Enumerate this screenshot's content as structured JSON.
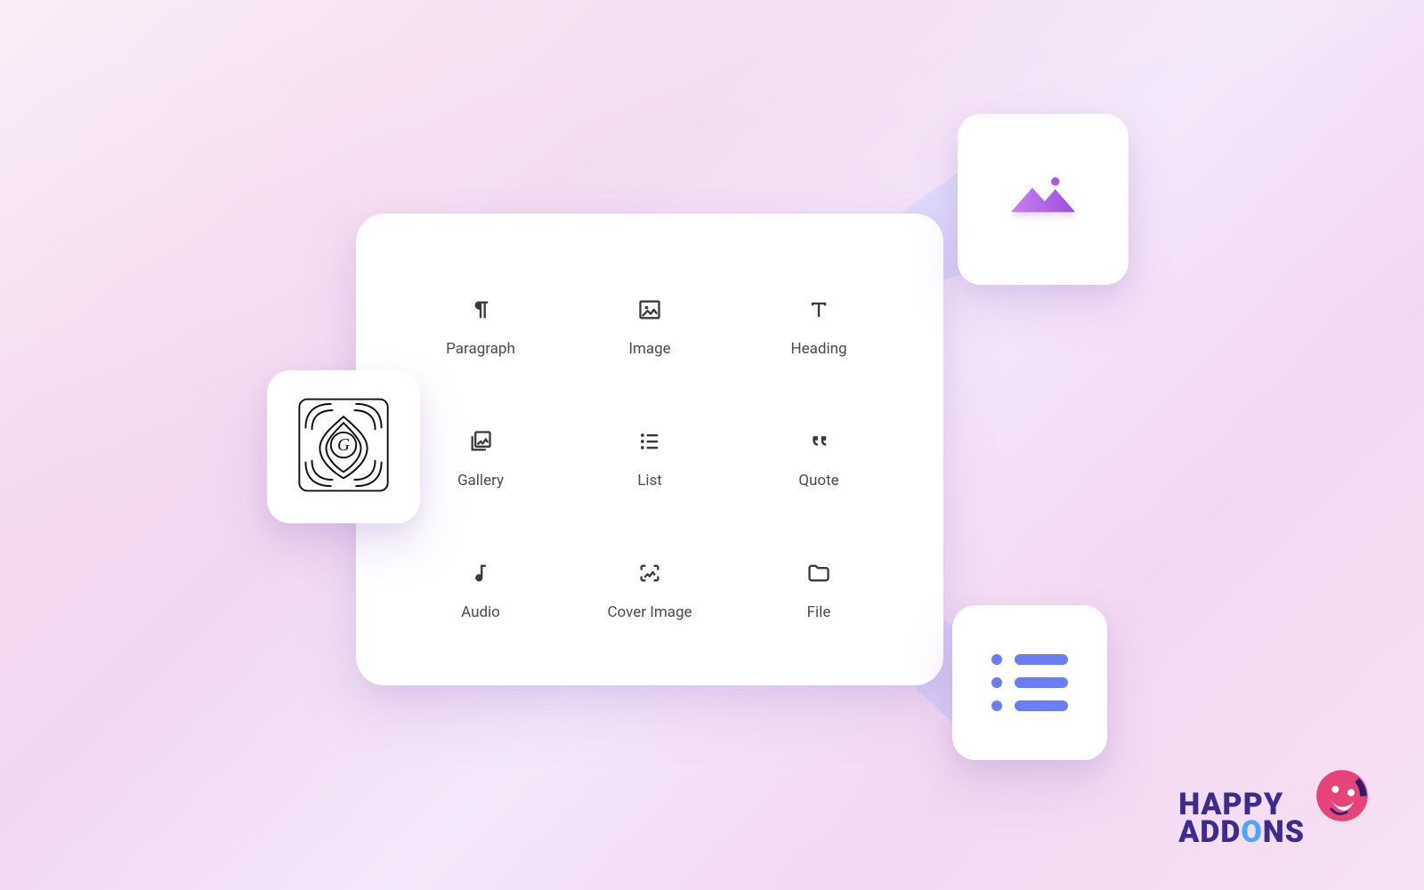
{
  "blocks": [
    {
      "key": "paragraph",
      "label": "Paragraph",
      "icon": "pilcrow-icon"
    },
    {
      "key": "image",
      "label": "Image",
      "icon": "image-icon"
    },
    {
      "key": "heading",
      "label": "Heading",
      "icon": "heading-t-icon"
    },
    {
      "key": "gallery",
      "label": "Gallery",
      "icon": "gallery-stack-icon"
    },
    {
      "key": "list",
      "label": "List",
      "icon": "list-icon"
    },
    {
      "key": "quote",
      "label": "Quote",
      "icon": "quote-icon"
    },
    {
      "key": "audio",
      "label": "Audio",
      "icon": "music-note-icon"
    },
    {
      "key": "coverimage",
      "label": "Cover Image",
      "icon": "cover-image-icon"
    },
    {
      "key": "file",
      "label": "File",
      "icon": "folder-icon"
    }
  ],
  "callouts": {
    "left": {
      "icon": "gutenberg-badge-icon"
    },
    "topright": {
      "icon": "image-mountains-icon"
    },
    "bottomright": {
      "icon": "list-lines-icon"
    }
  },
  "brand": {
    "line1": "HAPPY",
    "line2_pre": "ADD",
    "line2_o": "O",
    "line2_post": "NS",
    "icon": "happy-face-icon"
  },
  "colors": {
    "accent_purple": "#aa5ae0",
    "accent_blue": "#6b7df6",
    "brand_purple": "#3d2b8f",
    "brand_pink": "#e8427a"
  }
}
